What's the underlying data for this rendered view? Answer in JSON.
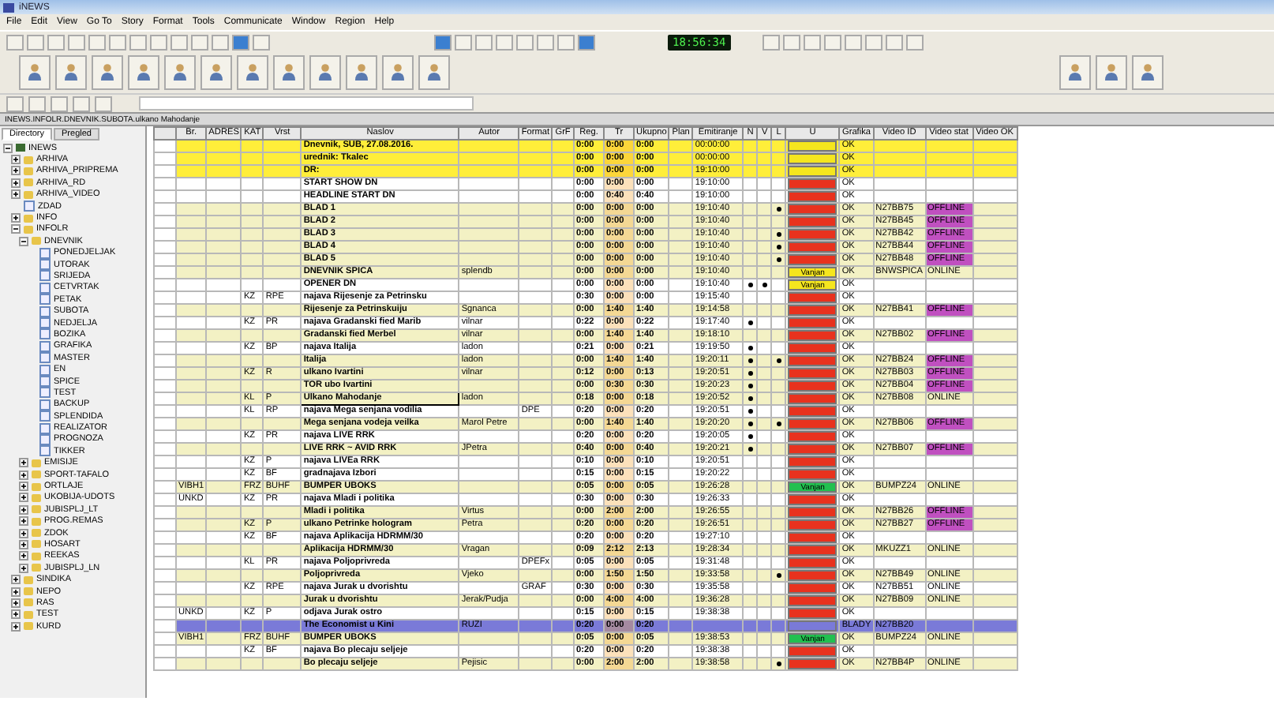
{
  "window": {
    "title": "iNEWS"
  },
  "menu": [
    "File",
    "Edit",
    "View",
    "Go To",
    "Story",
    "Format",
    "Tools",
    "Communicate",
    "Window",
    "Region",
    "Help"
  ],
  "clock": "18:56:34",
  "path": "INEWS.INFOLR.DNEVNIK.SUBOTA.ulkano Mahodanje",
  "sidebar": {
    "tabs": [
      {
        "label": "Directory",
        "selected": true
      },
      {
        "label": "Pregled",
        "selected": false
      }
    ],
    "tree": [
      {
        "label": "INEWS",
        "kind": "root",
        "expanded": true,
        "children": [
          {
            "label": "ARHIVA",
            "kind": "folder",
            "expanded": false
          },
          {
            "label": "ARHIVA_PRIPREMA",
            "kind": "folder",
            "expanded": false
          },
          {
            "label": "ARHIVA_RD",
            "kind": "folder",
            "expanded": false
          },
          {
            "label": "ARHIVA_VIDEO",
            "kind": "folder",
            "expanded": false
          },
          {
            "label": "ZDAD",
            "kind": "queue"
          },
          {
            "label": "INFO",
            "kind": "folder",
            "expanded": false
          },
          {
            "label": "INFOLR",
            "kind": "folder",
            "expanded": true,
            "children": [
              {
                "label": "DNEVNIK",
                "kind": "folder",
                "expanded": true,
                "children": [
                  {
                    "label": "PONEDJELJAK",
                    "kind": "queue"
                  },
                  {
                    "label": "UTORAK",
                    "kind": "queue"
                  },
                  {
                    "label": "SRIJEDA",
                    "kind": "queue"
                  },
                  {
                    "label": "CETVRTAK",
                    "kind": "queue"
                  },
                  {
                    "label": "PETAK",
                    "kind": "queue"
                  },
                  {
                    "label": "SUBOTA",
                    "kind": "queue"
                  },
                  {
                    "label": "NEDJELJA",
                    "kind": "queue"
                  },
                  {
                    "label": "BOZIKA",
                    "kind": "queue"
                  },
                  {
                    "label": "GRAFIKA",
                    "kind": "queue"
                  },
                  {
                    "label": "MASTER",
                    "kind": "queue"
                  },
                  {
                    "label": "EN",
                    "kind": "queue"
                  },
                  {
                    "label": "SPICE",
                    "kind": "queue"
                  },
                  {
                    "label": "TEST",
                    "kind": "queue"
                  },
                  {
                    "label": "BACKUP",
                    "kind": "queue"
                  },
                  {
                    "label": "SPLENDIDA",
                    "kind": "queue"
                  },
                  {
                    "label": "REALIZATOR",
                    "kind": "queue"
                  },
                  {
                    "label": "PROGNOZA",
                    "kind": "queue"
                  },
                  {
                    "label": "TIKKER",
                    "kind": "queue"
                  }
                ]
              },
              {
                "label": "EMISIJE",
                "kind": "folder",
                "expanded": false
              },
              {
                "label": "SPORT-TAFALO",
                "kind": "folder",
                "expanded": false
              },
              {
                "label": "ORTLAJE",
                "kind": "folder",
                "expanded": false
              },
              {
                "label": "UKOBIJA-UDOTS",
                "kind": "folder",
                "expanded": false
              },
              {
                "label": "JUBISPLJ_LT",
                "kind": "folder",
                "expanded": false
              },
              {
                "label": "PROG.REMAS",
                "kind": "folder",
                "expanded": false
              },
              {
                "label": "ZDOK",
                "kind": "folder",
                "expanded": false
              },
              {
                "label": "HOSART",
                "kind": "folder",
                "expanded": false
              },
              {
                "label": "REEKAS",
                "kind": "folder",
                "expanded": false
              },
              {
                "label": "JUBISPLJ_LN",
                "kind": "folder",
                "expanded": false
              }
            ]
          },
          {
            "label": "SINDIKA",
            "kind": "folder",
            "expanded": false
          },
          {
            "label": "NEPO",
            "kind": "folder",
            "expanded": false
          },
          {
            "label": "RAS",
            "kind": "folder",
            "expanded": false
          },
          {
            "label": "TEST",
            "kind": "folder",
            "expanded": false
          },
          {
            "label": "KURD",
            "kind": "folder",
            "expanded": false
          }
        ]
      }
    ]
  },
  "table": {
    "columns": [
      "Br.",
      "ADRES",
      "KAT",
      "Vrst",
      "Naslov",
      "Autor",
      "Format",
      "GrF",
      "Reg.",
      "Tr",
      "Ukupno",
      "Plan",
      "Emitiranje",
      "N",
      "V",
      "L",
      "U",
      "Grafika",
      "Video ID",
      "Video stat",
      "Video OK"
    ],
    "rows": [
      {
        "color": "#ffee3a",
        "naslov": "Dnevnik, SUB, 27.08.2016.",
        "reg": "0:00",
        "tr": "0:00",
        "ukupno": "0:00",
        "emit": "00:00:00",
        "n": false,
        "v": false,
        "l": false,
        "status": {
          "color": "#f5e61e"
        },
        "grafika": "OK"
      },
      {
        "color": "#ffee3a",
        "naslov": "urednik: Tkalec",
        "reg": "0:00",
        "tr": "0:00",
        "ukupno": "0:00",
        "emit": "00:00:00",
        "n": false,
        "v": false,
        "l": false,
        "status": {
          "color": "#f5e61e"
        },
        "grafika": "OK"
      },
      {
        "color": "#ffee3a",
        "naslov": "DR:",
        "reg": "0:00",
        "tr": "0:00",
        "ukupno": "0:00",
        "emit": "19:10:00",
        "n": false,
        "v": false,
        "l": false,
        "status": {
          "color": "#f5e61e"
        },
        "grafika": "OK"
      },
      {
        "color": "#ffffff",
        "naslov": "START SHOW DN",
        "reg": "0:00",
        "tr": "0:00",
        "ukupno": "0:00",
        "emit": "19:10:00",
        "n": false,
        "v": false,
        "l": false,
        "status": {
          "color": "#e8321e"
        },
        "grafika": "OK"
      },
      {
        "color": "#ffffff",
        "naslov": "HEADLINE START DN",
        "reg": "0:00",
        "tr": "0:40",
        "ukupno": "0:40",
        "emit": "19:10:00",
        "n": false,
        "v": false,
        "l": false,
        "status": {
          "color": "#e8321e"
        },
        "grafika": "OK"
      },
      {
        "color": "#f3f1c4",
        "naslov": "BLAD 1",
        "reg": "0:00",
        "tr": "0:00",
        "ukupno": "0:00",
        "emit": "19:10:40",
        "n": false,
        "v": false,
        "l": true,
        "status": {
          "color": "#e8321e"
        },
        "grafika": "OK",
        "video_id": "N27BB75",
        "video_status": {
          "text": "OFFLINE",
          "color": "#c050c0"
        }
      },
      {
        "color": "#f3f1c4",
        "naslov": "BLAD 2",
        "reg": "0:00",
        "tr": "0:00",
        "ukupno": "0:00",
        "emit": "19:10:40",
        "n": false,
        "v": false,
        "l": false,
        "status": {
          "color": "#e8321e"
        },
        "grafika": "OK",
        "video_id": "N27BB45",
        "video_status": {
          "text": "OFFLINE",
          "color": "#c050c0"
        }
      },
      {
        "color": "#f3f1c4",
        "naslov": "BLAD 3",
        "reg": "0:00",
        "tr": "0:00",
        "ukupno": "0:00",
        "emit": "19:10:40",
        "n": false,
        "v": false,
        "l": true,
        "status": {
          "color": "#e8321e"
        },
        "grafika": "OK",
        "video_id": "N27BB42",
        "video_status": {
          "text": "OFFLINE",
          "color": "#c050c0"
        }
      },
      {
        "color": "#f3f1c4",
        "naslov": "BLAD 4",
        "reg": "0:00",
        "tr": "0:00",
        "ukupno": "0:00",
        "emit": "19:10:40",
        "n": false,
        "v": false,
        "l": true,
        "status": {
          "color": "#e8321e"
        },
        "grafika": "OK",
        "video_id": "N27BB44",
        "video_status": {
          "text": "OFFLINE",
          "color": "#c050c0"
        }
      },
      {
        "color": "#f3f1c4",
        "naslov": "BLAD 5",
        "reg": "0:00",
        "tr": "0:00",
        "ukupno": "0:00",
        "emit": "19:10:40",
        "n": false,
        "v": false,
        "l": true,
        "status": {
          "color": "#e8321e"
        },
        "grafika": "OK",
        "video_id": "N27BB48",
        "video_status": {
          "text": "OFFLINE",
          "color": "#c050c0"
        }
      },
      {
        "color": "#f3f1c4",
        "naslov": "DNEVNIK SPICA",
        "autor": "splendb",
        "reg": "0:00",
        "tr": "0:00",
        "ukupno": "0:00",
        "emit": "19:10:40",
        "n": false,
        "v": false,
        "l": false,
        "status": {
          "color": "#f5e61e",
          "text": "Vanjan"
        },
        "grafika": "OK",
        "video_id": "BNWSPICA",
        "video_status": {
          "text": "ONLINE"
        }
      },
      {
        "color": "#ffffff",
        "naslov": "OPENER DN",
        "reg": "0:00",
        "tr": "0:00",
        "ukupno": "0:00",
        "emit": "19:10:40",
        "n": true,
        "v": true,
        "l": false,
        "status": {
          "color": "#f5e61e",
          "text": "Vanjan"
        },
        "grafika": "OK"
      },
      {
        "color": "#ffffff",
        "kat": "KZ",
        "vrst": "RPE",
        "naslov": "najava Rijesenje za Petrinsku",
        "reg": "0:30",
        "tr": "0:00",
        "ukupno": "0:00",
        "emit": "19:15:40",
        "n": false,
        "v": false,
        "l": false,
        "status": {
          "color": "#e8321e"
        },
        "grafika": "OK"
      },
      {
        "color": "#f3f1c4",
        "naslov": "Rijesenje za Petrinskuiju",
        "autor": "Sgnanca",
        "reg": "0:00",
        "tr": "1:40",
        "ukupno": "1:40",
        "emit": "19:14:58",
        "n": false,
        "v": false,
        "l": false,
        "status": {
          "color": "#e8321e"
        },
        "grafika": "OK",
        "video_id": "N27BB41",
        "video_status": {
          "text": "OFFLINE",
          "color": "#c050c0"
        }
      },
      {
        "color": "#ffffff",
        "kat": "KZ",
        "vrst": "PR",
        "naslov": "najava Gradanski fied Marib",
        "autor": "vilnar",
        "reg": "0:22",
        "tr": "0:00",
        "ukupno": "0:22",
        "emit": "19:17:40",
        "n": true,
        "v": false,
        "l": false,
        "status": {
          "color": "#e8321e"
        },
        "grafika": "OK"
      },
      {
        "color": "#f3f1c4",
        "naslov": "Gradanski fied Merbel",
        "autor": "vilnar",
        "reg": "0:00",
        "tr": "1:40",
        "ukupno": "1:40",
        "emit": "19:18:10",
        "n": false,
        "v": false,
        "l": false,
        "status": {
          "color": "#e8321e"
        },
        "grafika": "OK",
        "video_id": "N27BB02",
        "video_status": {
          "text": "OFFLINE",
          "color": "#c050c0"
        }
      },
      {
        "color": "#ffffff",
        "kat": "KZ",
        "vrst": "BP",
        "naslov": "najava Italija",
        "autor": "ladon",
        "reg": "0:21",
        "tr": "0:00",
        "ukupno": "0:21",
        "emit": "19:19:50",
        "n": true,
        "v": false,
        "l": false,
        "status": {
          "color": "#e8321e"
        },
        "grafika": "OK"
      },
      {
        "color": "#f3f1c4",
        "naslov": "Italija",
        "autor": "ladon",
        "reg": "0:00",
        "tr": "1:40",
        "ukupno": "1:40",
        "emit": "19:20:11",
        "n": true,
        "v": false,
        "l": true,
        "status": {
          "color": "#e8321e"
        },
        "grafika": "OK",
        "video_id": "N27BB24",
        "video_status": {
          "text": "OFFLINE",
          "color": "#c050c0"
        }
      },
      {
        "color": "#f3f1c4",
        "kat": "KZ",
        "vrst": "R",
        "naslov": "ulkano Ivartini",
        "autor": "vilnar",
        "reg": "0:12",
        "tr": "0:00",
        "ukupno": "0:13",
        "emit": "19:20:51",
        "n": true,
        "v": false,
        "l": false,
        "status": {
          "color": "#e8321e"
        },
        "grafika": "OK",
        "video_id": "N27BB03",
        "video_status": {
          "text": "OFFLINE",
          "color": "#c050c0"
        }
      },
      {
        "color": "#f3f1c4",
        "naslov": "TOR ubo Ivartini",
        "reg": "0:00",
        "tr": "0:30",
        "ukupno": "0:30",
        "emit": "19:20:23",
        "n": true,
        "v": false,
        "l": false,
        "status": {
          "color": "#e8321e"
        },
        "grafika": "OK",
        "video_id": "N27BB04",
        "video_status": {
          "text": "OFFLINE",
          "color": "#c050c0"
        }
      },
      {
        "color": "#f3f1c4",
        "kat": "KL",
        "vrst": "P",
        "naslov": "Ulkano Mahodanje",
        "focused": true,
        "autor": "ladon",
        "reg": "0:18",
        "tr": "0:00",
        "ukupno": "0:18",
        "emit": "19:20:52",
        "n": true,
        "v": false,
        "l": false,
        "status": {
          "color": "#e8321e"
        },
        "grafika": "OK",
        "video_id": "N27BB08",
        "video_status": {
          "text": "ONLINE"
        }
      },
      {
        "color": "#ffffff",
        "kat": "KL",
        "vrst": "RP",
        "naslov": "najava Mega senjana vodilia",
        "format": "DPE",
        "reg": "0:20",
        "tr": "0:00",
        "ukupno": "0:20",
        "emit": "19:20:51",
        "n": true,
        "v": false,
        "l": false,
        "status": {
          "color": "#e8321e"
        },
        "grafika": "OK"
      },
      {
        "color": "#f3f1c4",
        "naslov": "Mega senjana vodeja veilka",
        "autor": "Marol Petre",
        "reg": "0:00",
        "tr": "1:40",
        "ukupno": "1:40",
        "emit": "19:20:20",
        "n": true,
        "v": false,
        "l": true,
        "status": {
          "color": "#e8321e"
        },
        "grafika": "OK",
        "video_id": "N27BB06",
        "video_status": {
          "text": "OFFLINE",
          "color": "#c050c0"
        }
      },
      {
        "color": "#ffffff",
        "kat": "KZ",
        "vrst": "PR",
        "naslov": "najava LIVE RRK",
        "reg": "0:20",
        "tr": "0:00",
        "ukupno": "0:20",
        "emit": "19:20:05",
        "n": true,
        "v": false,
        "l": false,
        "status": {
          "color": "#e8321e"
        },
        "grafika": "OK"
      },
      {
        "color": "#f3f1c4",
        "naslov": "LIVE RRK ~ AVID RRK",
        "autor": "JPetra",
        "reg": "0:40",
        "tr": "0:00",
        "ukupno": "0:40",
        "emit": "19:20:21",
        "n": true,
        "v": false,
        "l": false,
        "status": {
          "color": "#e8321e"
        },
        "grafika": "OK",
        "video_id": "N27BB07",
        "video_status": {
          "text": "OFFLINE",
          "color": "#c050c0"
        }
      },
      {
        "color": "#ffffff",
        "kat": "KZ",
        "vrst": "P",
        "naslov": "najava LIVEa RRK",
        "reg": "0:10",
        "tr": "0:00",
        "ukupno": "0:10",
        "emit": "19:20:51",
        "n": false,
        "v": false,
        "l": false,
        "status": {
          "color": "#e8321e"
        },
        "grafika": "OK"
      },
      {
        "color": "#ffffff",
        "kat": "KZ",
        "vrst": "BF",
        "naslov": "gradnajava Izbori",
        "reg": "0:15",
        "tr": "0:00",
        "ukupno": "0:15",
        "emit": "19:20:22",
        "n": false,
        "v": false,
        "l": false,
        "status": {
          "color": "#e8321e"
        },
        "grafika": "OK"
      },
      {
        "color": "#f3f1c4",
        "br": "VIBH1",
        "kat": "FRZ",
        "vrst": "BUHF",
        "naslov": "BUMPER UBOKS",
        "reg": "0:05",
        "tr": "0:00",
        "ukupno": "0:05",
        "emit": "19:26:28",
        "n": false,
        "v": false,
        "l": false,
        "status": {
          "color": "#22c050",
          "text": "Vanjan"
        },
        "grafika": "OK",
        "video_id": "BUMPZ24",
        "video_status": {
          "text": "ONLINE"
        }
      },
      {
        "color": "#ffffff",
        "br": "UNKD",
        "kat": "KZ",
        "vrst": "PR",
        "naslov": "najava Mladi i politika",
        "reg": "0:30",
        "tr": "0:00",
        "ukupno": "0:30",
        "emit": "19:26:33",
        "n": false,
        "v": false,
        "l": false,
        "status": {
          "color": "#e8321e"
        },
        "grafika": "OK"
      },
      {
        "color": "#f3f1c4",
        "naslov": "Mladi i politika",
        "autor": "Virtus",
        "reg": "0:00",
        "tr": "2:00",
        "ukupno": "2:00",
        "emit": "19:26:55",
        "n": false,
        "v": false,
        "l": false,
        "status": {
          "color": "#e8321e"
        },
        "grafika": "OK",
        "video_id": "N27BB26",
        "video_status": {
          "text": "OFFLINE",
          "color": "#c050c0"
        }
      },
      {
        "color": "#f3f1c4",
        "kat": "KZ",
        "vrst": "P",
        "naslov": "ulkano Petrinke hologram",
        "autor": "Petra",
        "reg": "0:20",
        "tr": "0:00",
        "ukupno": "0:20",
        "emit": "19:26:51",
        "n": false,
        "v": false,
        "l": false,
        "status": {
          "color": "#e8321e"
        },
        "grafika": "OK",
        "video_id": "N27BB27",
        "video_status": {
          "text": "OFFLINE",
          "color": "#c050c0"
        }
      },
      {
        "color": "#ffffff",
        "kat": "KZ",
        "vrst": "BF",
        "naslov": "najava Aplikacija HDRMM/30",
        "reg": "0:20",
        "tr": "0:00",
        "ukupno": "0:20",
        "emit": "19:27:10",
        "n": false,
        "v": false,
        "l": false,
        "status": {
          "color": "#e8321e"
        },
        "grafika": "OK"
      },
      {
        "color": "#f3f1c4",
        "naslov": "Aplikacija HDRMM/30",
        "autor": "Vragan",
        "reg": "0:09",
        "tr": "2:12",
        "ukupno": "2:13",
        "emit": "19:28:34",
        "n": false,
        "v": false,
        "l": false,
        "status": {
          "color": "#e8321e"
        },
        "grafika": "OK",
        "video_id": "MKUZZ1",
        "video_status": {
          "text": "ONLINE"
        }
      },
      {
        "color": "#ffffff",
        "kat": "KL",
        "vrst": "PR",
        "naslov": "najava Poljoprivreda",
        "format": "DPEFx",
        "reg": "0:05",
        "tr": "0:00",
        "ukupno": "0:05",
        "emit": "19:31:48",
        "n": false,
        "v": false,
        "l": false,
        "status": {
          "color": "#e8321e"
        },
        "grafika": "OK"
      },
      {
        "color": "#f3f1c4",
        "naslov": "Poljoprivreda",
        "autor": "Vjeko",
        "reg": "0:00",
        "tr": "1:50",
        "ukupno": "1:50",
        "emit": "19:33:58",
        "n": false,
        "v": false,
        "l": true,
        "status": {
          "color": "#e8321e"
        },
        "grafika": "OK",
        "video_id": "N27BB49",
        "video_status": {
          "text": "ONLINE"
        }
      },
      {
        "color": "#ffffff",
        "kat": "KZ",
        "vrst": "RPE",
        "naslov": "najava Jurak u dvorishtu",
        "format": "GRAF",
        "reg": "0:30",
        "tr": "0:00",
        "ukupno": "0:30",
        "emit": "19:35:58",
        "n": false,
        "v": false,
        "l": false,
        "status": {
          "color": "#e8321e"
        },
        "grafika": "OK",
        "video_id": "N27BB51",
        "video_status": {
          "text": "ONLINE"
        }
      },
      {
        "color": "#f3f1c4",
        "naslov": "Jurak u dvorishtu",
        "autor": "Jerak/Pudja",
        "reg": "0:00",
        "tr": "4:00",
        "ukupno": "4:00",
        "emit": "19:36:28",
        "n": false,
        "v": false,
        "l": false,
        "status": {
          "color": "#e8321e"
        },
        "grafika": "OK",
        "video_id": "N27BB09",
        "video_status": {
          "text": "ONLINE"
        }
      },
      {
        "color": "#ffffff",
        "br": "UNKD",
        "kat": "KZ",
        "vrst": "P",
        "naslov": "odjava Jurak ostro",
        "reg": "0:15",
        "tr": "0:00",
        "ukupno": "0:15",
        "emit": "19:38:38",
        "n": false,
        "v": false,
        "l": false,
        "status": {
          "color": "#e8321e"
        },
        "grafika": "OK"
      },
      {
        "color": "#7a7ad8",
        "naslov": "The Economist u Kini",
        "autor": "RUZI",
        "reg": "0:20",
        "tr": "0:00",
        "ukupno": "0:20",
        "n": false,
        "v": false,
        "l": false,
        "status": {
          "color": "#7a7ad8"
        },
        "grafika": "BLADY",
        "video_id": "N27BB20"
      },
      {
        "color": "#f3f1c4",
        "br": "VIBH1",
        "kat": "FRZ",
        "vrst": "BUHF",
        "naslov": "BUMPER UBOKS",
        "reg": "0:05",
        "tr": "0:00",
        "ukupno": "0:05",
        "emit": "19:38:53",
        "n": false,
        "v": false,
        "l": false,
        "status": {
          "color": "#22c050",
          "text": "Vanjan"
        },
        "grafika": "OK",
        "video_id": "BUMPZ24",
        "video_status": {
          "text": "ONLINE"
        }
      },
      {
        "color": "#ffffff",
        "kat": "KZ",
        "vrst": "BF",
        "naslov": "najava Bo plecaju seljeje",
        "reg": "0:20",
        "tr": "0:00",
        "ukupno": "0:20",
        "emit": "19:38:38",
        "n": false,
        "v": false,
        "l": false,
        "status": {
          "color": "#e8321e"
        },
        "grafika": "OK"
      },
      {
        "color": "#f3f1c4",
        "naslov": "Bo plecaju seljeje",
        "autor": "Pejisic",
        "reg": "0:00",
        "tr": "2:00",
        "ukupno": "2:00",
        "emit": "19:38:58",
        "n": false,
        "v": false,
        "l": true,
        "status": {
          "color": "#e8321e"
        },
        "grafika": "OK",
        "video_id": "N27BB4P",
        "video_status": {
          "text": "ONLINE"
        }
      }
    ]
  }
}
